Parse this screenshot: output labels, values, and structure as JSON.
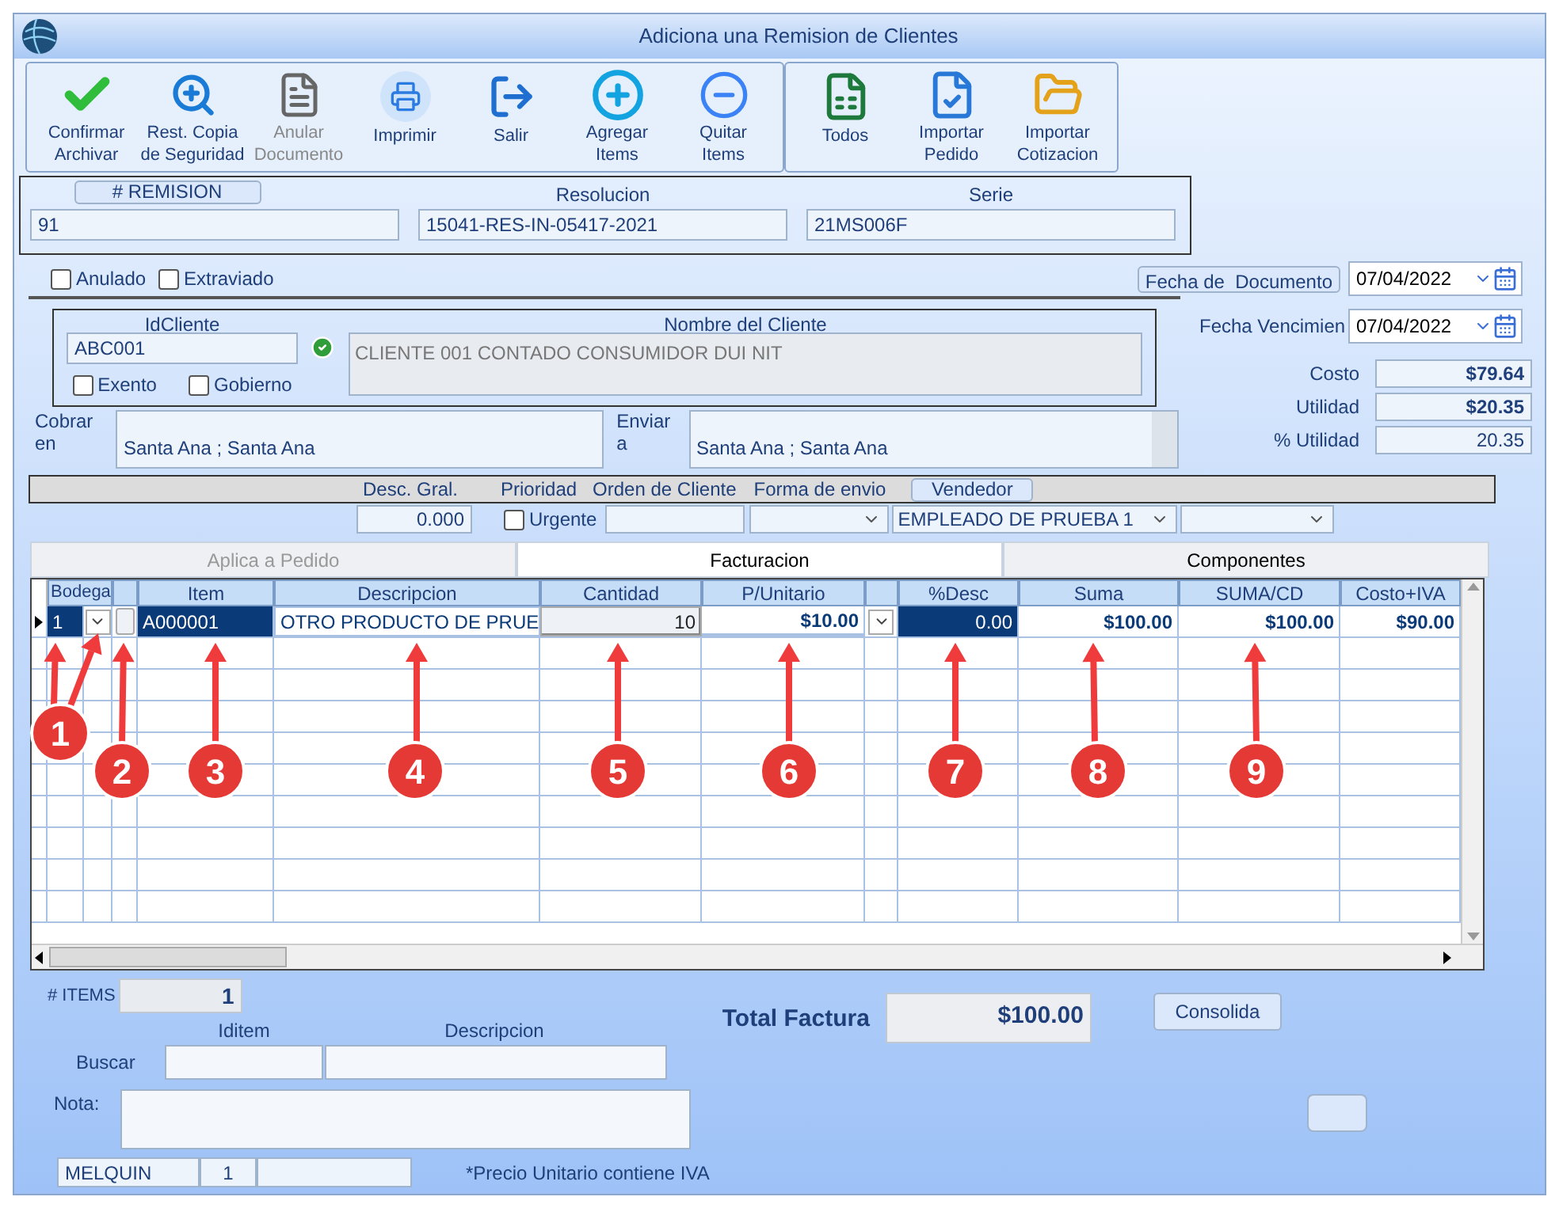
{
  "window": {
    "title": "Adiciona una Remision de Clientes"
  },
  "toolbar_groups": [
    [
      {
        "label": "Confirmar\nArchivar",
        "kind": "check",
        "disabled": false
      },
      {
        "label": "Rest. Copia\nde Seguridad",
        "kind": "zoom",
        "disabled": false
      },
      {
        "label": "Anular\nDocumento",
        "kind": "document",
        "disabled": true
      },
      {
        "label": "Imprimir",
        "kind": "printer",
        "disabled": false
      },
      {
        "label": "Salir",
        "kind": "exit",
        "disabled": false
      },
      {
        "label": "Agregar\nItems",
        "kind": "plus",
        "disabled": false
      },
      {
        "label": "Quitar\nItems",
        "kind": "minus",
        "disabled": false
      }
    ],
    [
      {
        "label": "Todos",
        "kind": "sheet",
        "disabled": false
      },
      {
        "label": "Importar\nPedido",
        "kind": "import",
        "disabled": false
      },
      {
        "label": "Importar\nCotizacion",
        "kind": "quote",
        "disabled": false
      }
    ]
  ],
  "header_fields": [
    {
      "label": "# REMISION",
      "kind": "button",
      "value": "91"
    },
    {
      "label": "Resolucion",
      "kind": "label",
      "value": "15041-RES-IN-05417-2021"
    },
    {
      "label": "Serie",
      "kind": "label",
      "value": "21MS006F"
    }
  ],
  "flags": [
    {
      "label": "Anulado",
      "checked": false
    },
    {
      "label": "Extraviado",
      "checked": false
    }
  ],
  "fecha_documento": {
    "label": "Fecha de  Documento",
    "value": "07/04/2022"
  },
  "cliente": {
    "id_label": "IdCliente",
    "id": "ABC001",
    "verified": true,
    "name_label": "Nombre del Cliente",
    "name": "CLIENTE 001 CONTADO CONSUMIDOR DUI NIT",
    "options": [
      {
        "label": "Exento",
        "checked": false
      },
      {
        "label": "Gobierno",
        "checked": false
      }
    ]
  },
  "fecha_vencimiento": {
    "label": "Fecha Vencimien",
    "value": "07/04/2022"
  },
  "totals": [
    {
      "label": "Costo",
      "value": "$79.64",
      "bold": true
    },
    {
      "label": "Utilidad",
      "value": "$20.35",
      "bold": true
    },
    {
      "label": "% Utilidad",
      "value": "20.35",
      "bold": false
    }
  ],
  "cobrar": {
    "label": "Cobrar\nen",
    "value": "Santa Ana ; Santa Ana"
  },
  "enviar": {
    "label": "Enviar\na",
    "value": "Santa Ana ; Santa Ana"
  },
  "order_bar": {
    "desc_label": "Desc. Gral.",
    "desc_value": "0.000",
    "prioridad_label": "Prioridad",
    "urgente": {
      "label": "Urgente",
      "checked": false
    },
    "orden_label": "Orden de Cliente",
    "envio_label": "Forma de envio",
    "vendedor_label": "Vendedor",
    "vendedor_value": "EMPLEADO DE PRUEBA 1"
  },
  "tabs": [
    {
      "label": "Aplica a Pedido",
      "selected": false,
      "disabled": true
    },
    {
      "label": "Facturacion",
      "selected": true,
      "disabled": false
    },
    {
      "label": "Componentes",
      "selected": false,
      "disabled": false
    }
  ],
  "table": {
    "columns": [
      {
        "label": "Bodega",
        "kind": "text"
      },
      {
        "kind": "dropdown"
      },
      {
        "kind": "blank"
      },
      {
        "label": "Item",
        "kind": "text"
      },
      {
        "label": "Descripcion",
        "kind": "text"
      },
      {
        "label": "Cantidad",
        "kind": "text"
      },
      {
        "label": "P/Unitario",
        "kind": "text"
      },
      {
        "kind": "dropdown"
      },
      {
        "label": "%Desc",
        "kind": "text"
      },
      {
        "label": "Suma",
        "kind": "text"
      },
      {
        "label": "SUMA/CD",
        "kind": "text"
      },
      {
        "label": "Costo+IVA",
        "kind": "text"
      }
    ],
    "rows": [
      {
        "current": true,
        "cells": [
          "1",
          "",
          "",
          "A000001",
          "OTRO PRODUCTO DE PRUE",
          "10",
          "$10.00",
          "",
          "0.00",
          "$100.00",
          "$100.00",
          "$90.00"
        ]
      }
    ]
  },
  "annotations": [
    {
      "label": "1"
    },
    {
      "label": "2"
    },
    {
      "label": "3"
    },
    {
      "label": "4"
    },
    {
      "label": "5"
    },
    {
      "label": "6"
    },
    {
      "label": "7"
    },
    {
      "label": "8"
    },
    {
      "label": "9"
    }
  ],
  "footer": {
    "items_label": "# ITEMS",
    "items_value": "1",
    "total_label": "Total Factura",
    "total_value": "$100.00",
    "consolida": "Consolida",
    "buscar_label": "Buscar",
    "iditem_label": "Iditem",
    "descripcion_label": "Descripcion",
    "nota_label": "Nota:",
    "status": [
      "MELQUIN",
      "1"
    ],
    "note": "*Precio Unitario contiene IVA"
  }
}
